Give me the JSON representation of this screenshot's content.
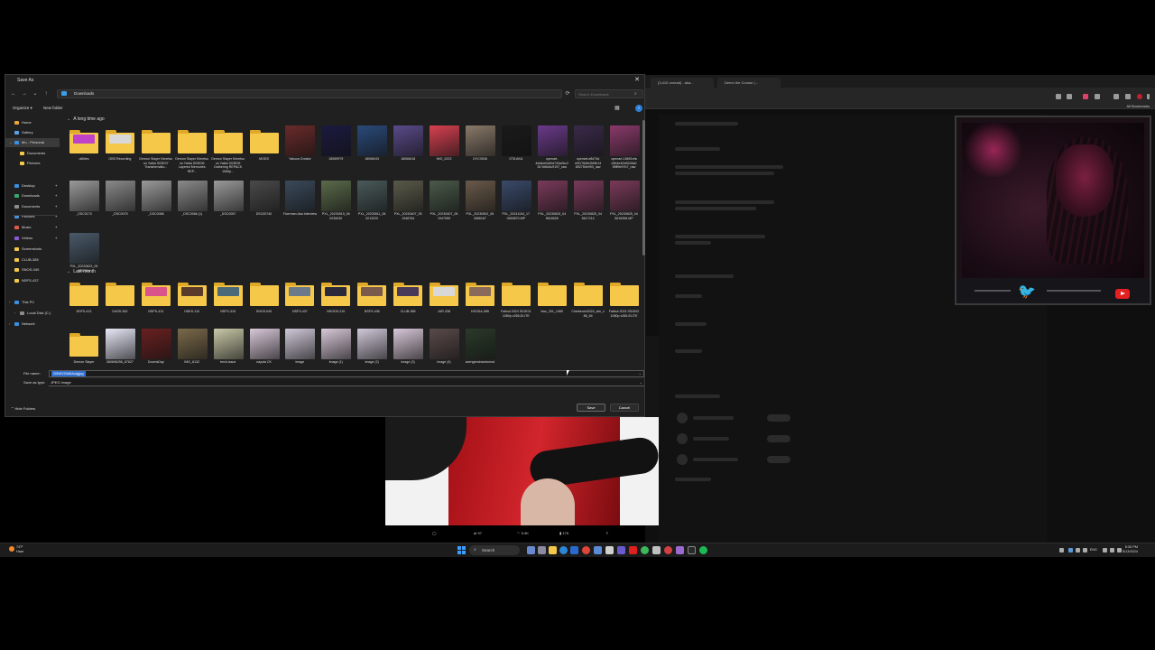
{
  "browser": {
    "tabs": [
      "(3,410 unread) - aka...",
      "Demo the Course |..."
    ],
    "bookmarks_label": "All Bookmarks"
  },
  "dialog": {
    "title": "Save As",
    "close_glyph": "✕",
    "address_path": "Downloads",
    "search_placeholder": "Search Downloads",
    "toolbar": {
      "organize": "Organize ▾",
      "new_folder": "New folder"
    },
    "sidebar": [
      {
        "label": "Home",
        "icon_color": "#e8a53a"
      },
      {
        "label": "Gallery",
        "icon_color": "#5aa0e6"
      },
      {
        "label": "Mo - Personal",
        "icon_color": "#3a8fe0"
      },
      {
        "label": "Documents",
        "icon_color": "#f5c84a"
      },
      {
        "label": "Pictures",
        "icon_color": "#f5c84a"
      },
      {
        "label": "Desktop",
        "icon_color": "#3a8fe0"
      },
      {
        "label": "Downloads",
        "icon_color": "#3aa86a"
      },
      {
        "label": "Documents",
        "icon_color": "#8c8c8c"
      },
      {
        "label": "Pictures",
        "icon_color": "#4a90d9"
      },
      {
        "label": "Music",
        "icon_color": "#e05a4a"
      },
      {
        "label": "Videos",
        "icon_color": "#8a5ad6"
      },
      {
        "label": "Screenshots",
        "icon_color": "#f5c84a"
      },
      {
        "label": "CLUB-385",
        "icon_color": "#f5c84a"
      },
      {
        "label": "SNOS-040",
        "icon_color": "#f5c84a"
      },
      {
        "label": "NSFS-437",
        "icon_color": "#f5c84a"
      },
      {
        "label": "This PC",
        "icon_color": "#3a8fe0"
      },
      {
        "label": "Local Disk (C:)",
        "icon_color": "#8c8c8c"
      },
      {
        "label": "Network",
        "icon_color": "#3a8fe0"
      }
    ],
    "groups": [
      {
        "label": "A long time ago"
      },
      {
        "label": "Last month"
      }
    ],
    "files_row1": [
      {
        "name": "utilities",
        "kind": "folder",
        "preview": "#c042c8"
      },
      {
        "name": "OBS Recording",
        "kind": "folder",
        "preview": "#d8d8d8"
      },
      {
        "name": "Demon Slayer Kimetsu no Yaiba S03E07 Transformatio...",
        "kind": "folder",
        "preview": ""
      },
      {
        "name": "Demon Slayer Kimetsu no Yaiba S03E06 Layered Memories REP...",
        "kind": "folder",
        "preview": ""
      },
      {
        "name": "Demon Slayer Kimetsu no Yaiba S03E05 Gathering REPACK 1080p...",
        "kind": "folder",
        "preview": ""
      },
      {
        "name": "MODS",
        "kind": "folder",
        "preview": ""
      },
      {
        "name": "Yakuza Creator",
        "kind": "image",
        "color": "#6a2a2a"
      },
      {
        "name": "18069979",
        "kind": "image",
        "color": "#1a1a40"
      },
      {
        "name": "18066043",
        "kind": "image",
        "color": "#2a4a7a"
      },
      {
        "name": "18066618",
        "kind": "image",
        "color": "#5a4a8a"
      },
      {
        "name": "IMG_0223",
        "kind": "image",
        "color": "#d84050"
      },
      {
        "name": "OYC0538",
        "kind": "image",
        "color": "#8a7a6a"
      },
      {
        "name": "GTA AKA",
        "kind": "image",
        "color": "#1a1a1a"
      },
      {
        "name": "openart-4efabe0c60d743a2bc235 9d5d4c9197_raw",
        "kind": "image",
        "color": "#6a3a8a"
      },
      {
        "name": "openart-e8d74d e0f1784fe2bf9b14 892750e993_raw",
        "kind": "image",
        "color": "#3a2a4a"
      },
      {
        "name": "openart-18691efa d3b4e40d92d3a0 f5fff9e97b7_raw",
        "kind": "image",
        "color": "#8a3a6a"
      }
    ],
    "files_row2": [
      {
        "name": "_DSC0170",
        "kind": "image",
        "color": "#9a9a9a"
      },
      {
        "name": "_DSC0075",
        "kind": "image",
        "color": "#8a8a8a"
      },
      {
        "name": "_DSC0066",
        "kind": "image",
        "color": "#9a9a9a"
      },
      {
        "name": "_DSC0066 (1)",
        "kind": "image",
        "color": "#8a8a8a"
      },
      {
        "name": "_DSC0057",
        "kind": "image",
        "color": "#9a9a9a"
      },
      {
        "name": "DSC00740",
        "kind": "image",
        "color": "#4a4a4a"
      },
      {
        "name": "Ficerman Aka Interview",
        "kind": "image",
        "color": "#3a4a5a"
      },
      {
        "name": "PXL_20230519_06 0235030",
        "kind": "image",
        "color": "#5a6a4a"
      },
      {
        "name": "PXL_20230511_06 0213220",
        "kind": "image",
        "color": "#4a5a5a"
      },
      {
        "name": "PXL_20230407_05 1948764",
        "kind": "image",
        "color": "#5a5a4a"
      },
      {
        "name": "PXL_20230407_05 1947959",
        "kind": "image",
        "color": "#4a5a4a"
      },
      {
        "name": "PXL_20230502_06 2856167",
        "kind": "image",
        "color": "#6a5a4a"
      },
      {
        "name": "PXL_20241104_17 0653870.MP",
        "kind": "image",
        "color": "#3a4a6a"
      },
      {
        "name": "PXL_20230825_04 5616528",
        "kind": "image",
        "color": "#7a3a5a"
      },
      {
        "name": "PXL_20230825_04 5617214",
        "kind": "image",
        "color": "#7a3a5a"
      },
      {
        "name": "PXL_20230825_04 5616356.MP",
        "kind": "image",
        "color": "#7a3a5a"
      }
    ],
    "files_row3": [
      {
        "name": "PXL_20220823_05 0837504",
        "kind": "image",
        "color": "#4a5a6a"
      }
    ],
    "files_row4": [
      {
        "name": "NSFS-413",
        "kind": "folder",
        "preview": ""
      },
      {
        "name": "DASS-300",
        "kind": "folder",
        "preview": ""
      },
      {
        "name": "NSPS-413",
        "kind": "folder",
        "preview": "#d8548a"
      },
      {
        "name": "HDKS-110",
        "kind": "folder",
        "preview": "#5a3a2a"
      },
      {
        "name": "NSFS-315",
        "kind": "folder",
        "preview": "#4a6a7a"
      },
      {
        "name": "SNOS-040",
        "kind": "folder",
        "preview": ""
      },
      {
        "name": "NSFS-437",
        "kind": "folder",
        "preview": "#6a7a8a"
      },
      {
        "name": "NSODS-210",
        "kind": "folder",
        "preview": "#2a2a3a"
      },
      {
        "name": "NSFS-436",
        "kind": "folder",
        "preview": "#7a5a4a"
      },
      {
        "name": "CLUB-385",
        "kind": "folder",
        "preview": "#4a3a5a"
      },
      {
        "name": "JUR-338",
        "kind": "folder",
        "preview": "#d8d8d8"
      },
      {
        "name": "HSODA-085",
        "kind": "folder",
        "preview": "#8a6a5a"
      },
      {
        "name": "Fallout 2024 S01E01 1080p x265-ELITE",
        "kind": "folder",
        "preview": ""
      },
      {
        "name": "bwc_331_1080",
        "kind": "folder",
        "preview": ""
      },
      {
        "name": "Cinebench2024_win_x86_64",
        "kind": "folder",
        "preview": ""
      },
      {
        "name": "Fallout 2024 S01E02 1080p x265-ELITE",
        "kind": "folder",
        "preview": ""
      }
    ],
    "files_row5": [
      {
        "name": "Demon Slayer",
        "kind": "folder",
        "preview": ""
      },
      {
        "name": "360696256_87627",
        "kind": "image",
        "color": "#e8e8f8"
      },
      {
        "name": "DoomsDay",
        "kind": "image",
        "color": "#6a2020"
      },
      {
        "name": "IMG_8132",
        "kind": "image",
        "color": "#7a6a4a"
      },
      {
        "name": "trech-issue",
        "kind": "image",
        "color": "#c8c8a8"
      },
      {
        "name": "nayuta CK",
        "kind": "image",
        "color": "#d8c8d8"
      },
      {
        "name": "image",
        "kind": "image",
        "color": "#d0c8d8"
      },
      {
        "name": "image (1)",
        "kind": "image",
        "color": "#d8c8d8"
      },
      {
        "name": "image (2)",
        "kind": "image",
        "color": "#d0c8d8"
      },
      {
        "name": "image (3)",
        "kind": "image",
        "color": "#d8c8d8"
      },
      {
        "name": "image (4)",
        "kind": "image",
        "color": "#5a4a4a"
      },
      {
        "name": "avengendowntomod",
        "kind": "image",
        "color": "#2a3a2a"
      }
    ],
    "file_name_label": "File name:",
    "file_name_value": "G5WVGk6IAuigjpg",
    "save_type_label": "Save as type:",
    "save_type_value": "JPEG Image",
    "hide_folders": "Hide Folders",
    "save": "Save",
    "cancel": "Cancel"
  },
  "tweet_actions": [
    "97",
    "5.9K",
    "17K"
  ],
  "taskbar": {
    "weather": [
      "74°F",
      "Haze"
    ],
    "search": "Search",
    "clock": [
      "5:30 PM",
      "5/13/2024"
    ],
    "lang": "ENG"
  },
  "colors": {
    "accent": "#2f6fd1",
    "folder": "#f5c84a",
    "dialog_bg": "#202020"
  }
}
